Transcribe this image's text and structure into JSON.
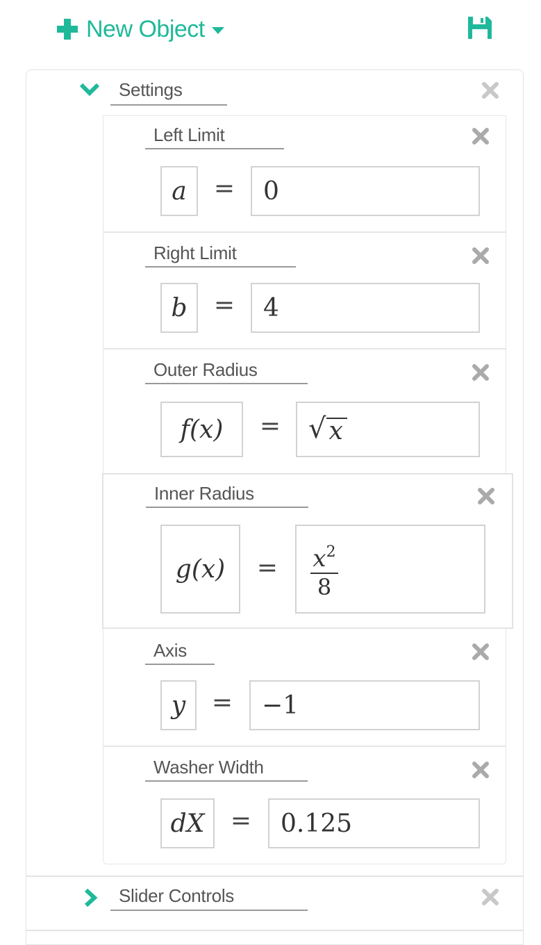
{
  "header": {
    "new_object_label": "New Object",
    "accent_color": "#1fb99a",
    "icons": [
      "plus-icon",
      "caret-down-icon",
      "save-icon"
    ]
  },
  "settings_group": {
    "label": "Settings",
    "expanded": true,
    "fields": [
      {
        "label": "Left Limit",
        "variable": "a",
        "value": "0"
      },
      {
        "label": "Right Limit",
        "variable": "b",
        "value": "4"
      },
      {
        "label": "Outer Radius",
        "variable": "f(x)",
        "value": "√x",
        "value_arg": "x"
      },
      {
        "label": "Inner Radius",
        "variable": "g(x)",
        "value": "x²/8",
        "value_num": "x",
        "value_exp": "2",
        "value_den": "8"
      },
      {
        "label": "Axis",
        "variable": "y",
        "value": "−1"
      },
      {
        "label": "Washer Width",
        "variable": "dX",
        "value": "0.125"
      }
    ],
    "equals_sign": "="
  },
  "slider_group": {
    "label": "Slider Controls",
    "expanded": false
  }
}
